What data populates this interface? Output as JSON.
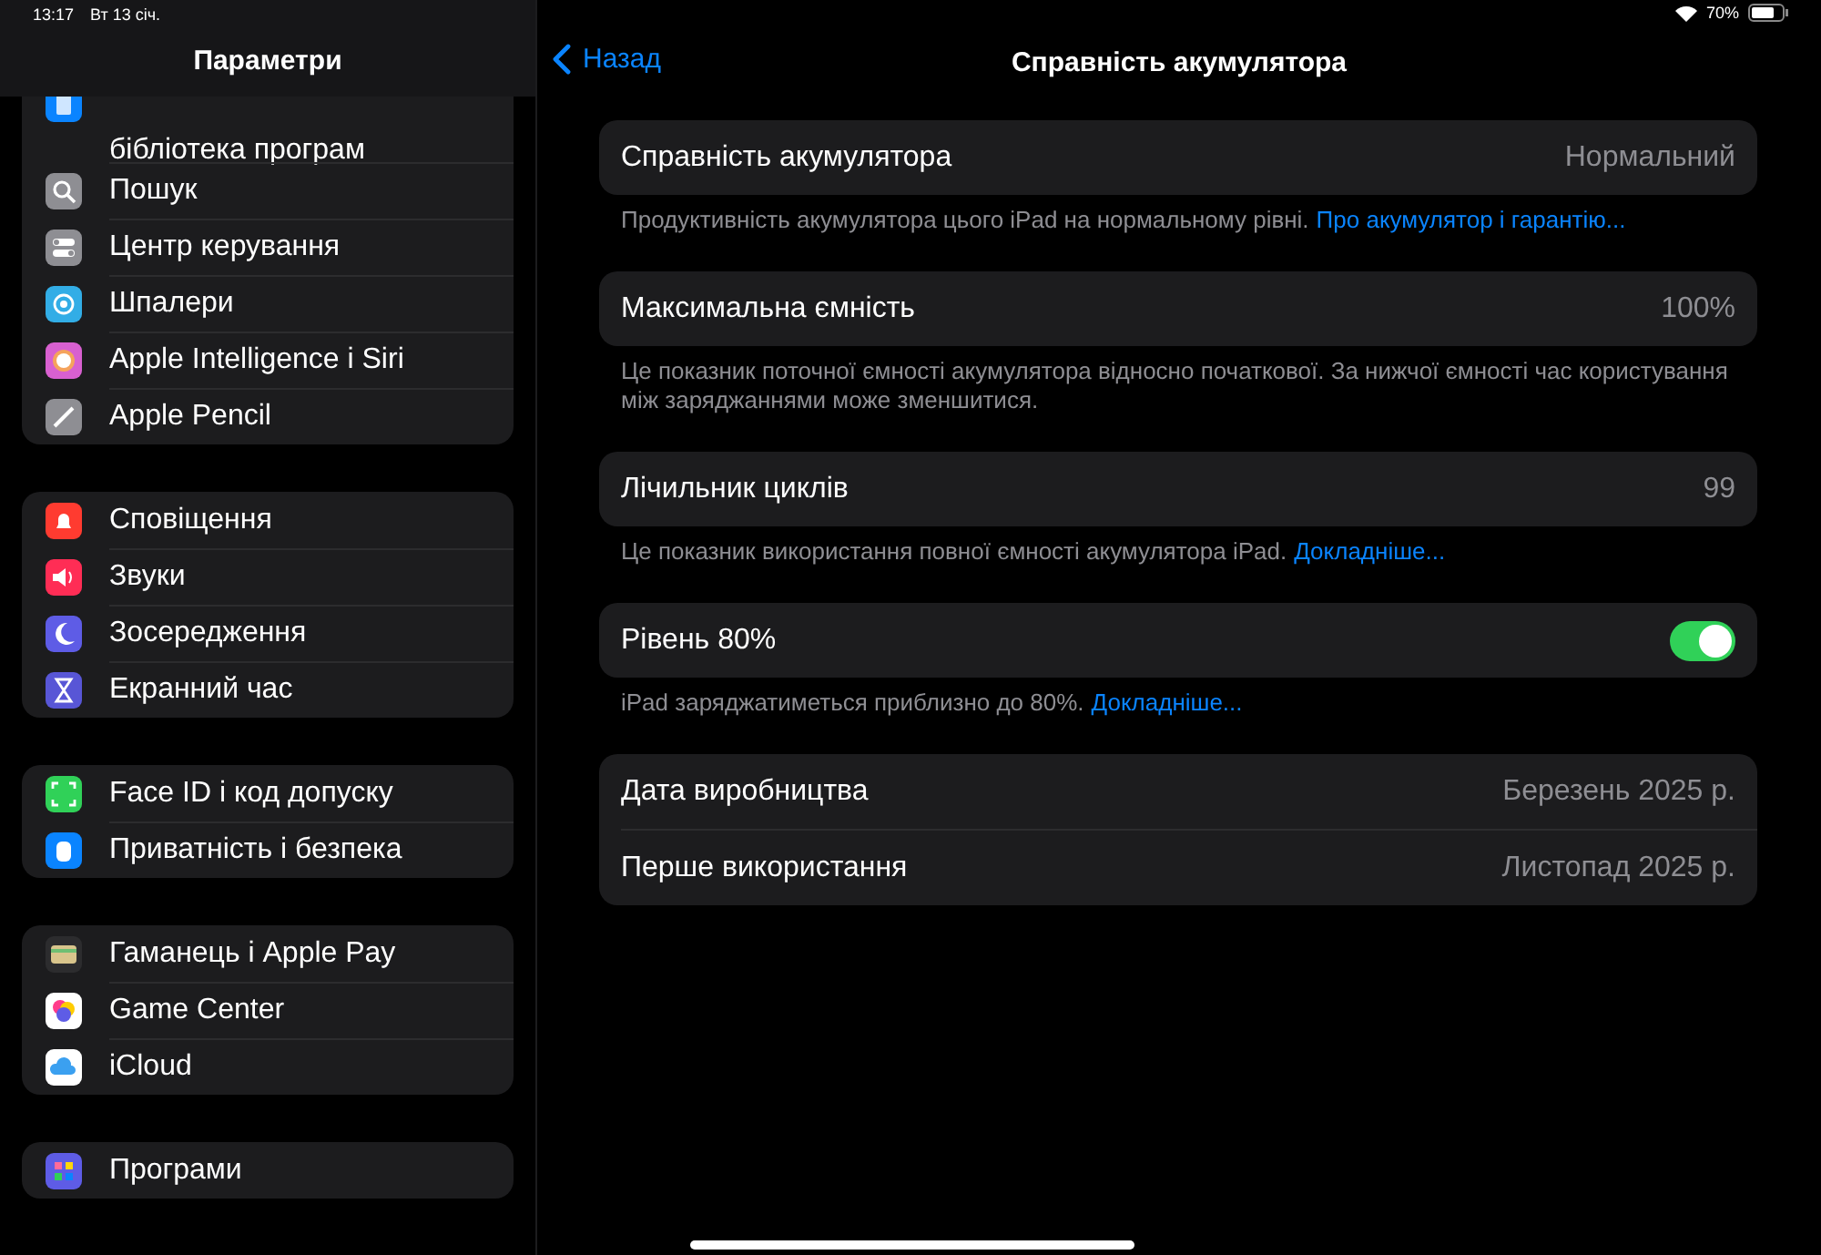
{
  "status_bar": {
    "time": "13:17",
    "date": "Вт 13 січ.",
    "battery": "70%"
  },
  "sidebar": {
    "title": "Параметри",
    "groups": [
      {
        "items": [
          {
            "label": "бібліотека програм",
            "cut": true
          },
          {
            "label": "Пошук"
          },
          {
            "label": "Центр керування"
          },
          {
            "label": "Шпалери"
          },
          {
            "label": "Apple Intelligence і Siri"
          },
          {
            "label": "Apple Pencil"
          }
        ]
      },
      {
        "items": [
          {
            "label": "Сповіщення"
          },
          {
            "label": "Звуки"
          },
          {
            "label": "Зосередження"
          },
          {
            "label": "Екранний час"
          }
        ]
      },
      {
        "items": [
          {
            "label": "Face ID і код допуску"
          },
          {
            "label": "Приватність і безпека"
          }
        ]
      },
      {
        "items": [
          {
            "label": "Гаманець і Apple Pay"
          },
          {
            "label": "Game Center"
          },
          {
            "label": "iCloud"
          }
        ]
      },
      {
        "items": [
          {
            "label": "Програми"
          }
        ]
      }
    ]
  },
  "nav": {
    "back": "Назад",
    "title": "Справність акумулятора"
  },
  "sections": [
    {
      "rows": [
        {
          "kind": "value",
          "label": "Справність акумулятора",
          "value": "Нормальний"
        }
      ],
      "footer": {
        "text": "Продуктивність акумулятора цього iPad на нормальному рівні.",
        "link": "Про акумулятор і гарантію..."
      }
    },
    {
      "rows": [
        {
          "kind": "value",
          "label": "Максимальна ємність",
          "value": "100%"
        }
      ],
      "footer": {
        "text": "Це показник поточної ємності акумулятора відносно початкової. За нижчої ємності час користування між заряджаннями може зменшитися."
      }
    },
    {
      "rows": [
        {
          "kind": "value",
          "label": "Лічильник циклів",
          "value": "99"
        }
      ],
      "footer": {
        "text": "Це показник використання повної ємності акумулятора iPad.",
        "link": "Докладніше..."
      }
    },
    {
      "rows": [
        {
          "kind": "toggle",
          "label": "Рівень 80%",
          "on": true
        }
      ],
      "footer": {
        "text": "iPad заряджатиметься приблизно до 80%.",
        "link": "Докладніше..."
      }
    },
    {
      "rows": [
        {
          "kind": "value",
          "label": "Дата виробництва",
          "value": "Березень 2025 р."
        },
        {
          "kind": "value",
          "label": "Перше використання",
          "value": "Листопад 2025 р."
        }
      ]
    }
  ]
}
